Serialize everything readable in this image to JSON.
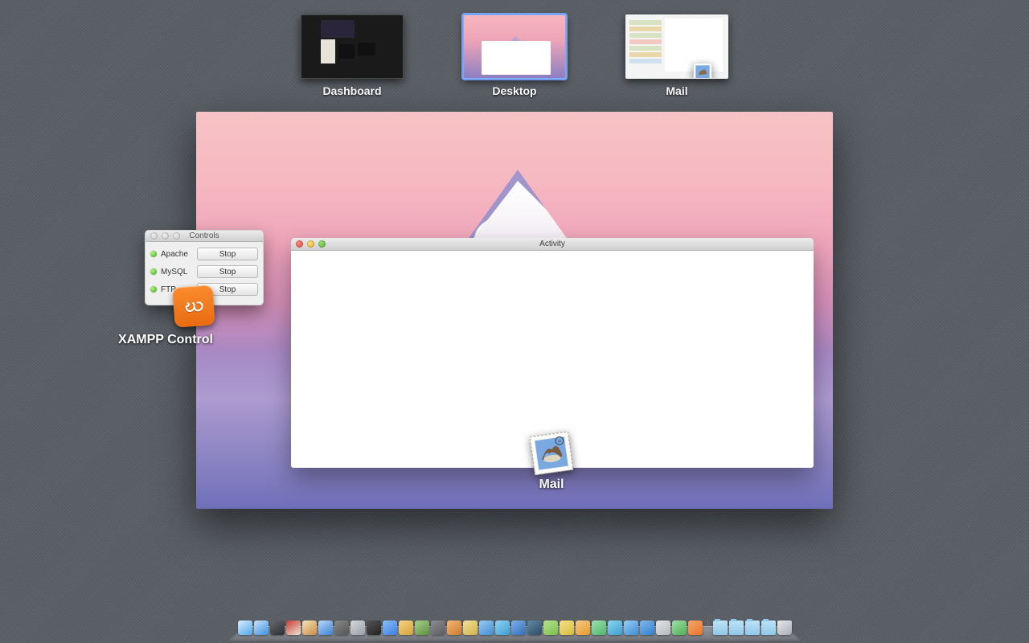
{
  "spaces": [
    {
      "id": "dashboard",
      "label": "Dashboard",
      "selected": false
    },
    {
      "id": "desktop",
      "label": "Desktop",
      "selected": true
    },
    {
      "id": "mail",
      "label": "Mail",
      "selected": false
    }
  ],
  "desktop_preview": {
    "activity_window": {
      "title": "Activity",
      "traffic": {
        "close": "red",
        "minimize": "yellow",
        "zoom": "green"
      }
    },
    "app_label": "Mail"
  },
  "xampp": {
    "window_title": "Controls",
    "services": [
      {
        "name": "Apache",
        "status": "running",
        "button": "Stop"
      },
      {
        "name": "MySQL",
        "status": "running",
        "button": "Stop"
      },
      {
        "name": "FTP",
        "status": "running",
        "button": "Stop"
      }
    ],
    "icon_text": "ဃ",
    "label": "XAMPP Control"
  },
  "dock": {
    "apps": [
      {
        "id": "finder",
        "c1": "#4aa7ee",
        "c2": "#dfeffb"
      },
      {
        "id": "safari",
        "c1": "#3f8fe0",
        "c2": "#c9e2f6"
      },
      {
        "id": "mission",
        "c1": "#2b2b30",
        "c2": "#6a6a72"
      },
      {
        "id": "calendar",
        "c1": "#efe7d6",
        "c2": "#c63a32"
      },
      {
        "id": "notes",
        "c1": "#c88a4b",
        "c2": "#f5e6b3"
      },
      {
        "id": "safari2",
        "c1": "#3a81d6",
        "c2": "#bcd9f2"
      },
      {
        "id": "photo",
        "c1": "#555",
        "c2": "#888"
      },
      {
        "id": "pref",
        "c1": "#9aa0a6",
        "c2": "#d4d7da"
      },
      {
        "id": "term",
        "c1": "#222",
        "c2": "#555"
      },
      {
        "id": "itunes",
        "c1": "#3b7fe2",
        "c2": "#8cbef3"
      },
      {
        "id": "imovie",
        "c1": "#d6a23a",
        "c2": "#f2d38a"
      },
      {
        "id": "app",
        "c1": "#5e8f3e",
        "c2": "#a7d18b"
      },
      {
        "id": "u1",
        "c1": "#5c5c60",
        "c2": "#8d8d92"
      },
      {
        "id": "u2",
        "c1": "#d07a2e",
        "c2": "#f0b877"
      },
      {
        "id": "u3",
        "c1": "#d2b24a",
        "c2": "#f2df9b"
      },
      {
        "id": "u4",
        "c1": "#3f8ed3",
        "c2": "#9ccaf0"
      },
      {
        "id": "u5",
        "c1": "#3aa0d8",
        "c2": "#93d2f2"
      },
      {
        "id": "word",
        "c1": "#2f6db8",
        "c2": "#7fb2e6"
      },
      {
        "id": "ps",
        "c1": "#2d4b63",
        "c2": "#5f8aa6"
      },
      {
        "id": "u6",
        "c1": "#7bbf4a",
        "c2": "#b7e38f"
      },
      {
        "id": "u7",
        "c1": "#d9bd3a",
        "c2": "#f2e08a"
      },
      {
        "id": "u8",
        "c1": "#e69a2e",
        "c2": "#f4c986"
      },
      {
        "id": "u9",
        "c1": "#4fb76a",
        "c2": "#9fe0b0"
      },
      {
        "id": "u10",
        "c1": "#3a9fd0",
        "c2": "#8fd4f0"
      },
      {
        "id": "spotify",
        "c1": "#3a8ed8",
        "c2": "#9bccf2"
      },
      {
        "id": "dropbox",
        "c1": "#2f7fcf",
        "c2": "#85b8e8"
      },
      {
        "id": "u11",
        "c1": "#b5b8bc",
        "c2": "#e3e5e8"
      },
      {
        "id": "u12",
        "c1": "#4fae55",
        "c2": "#a0e0a5"
      },
      {
        "id": "xampp",
        "c1": "#e8732a",
        "c2": "#f4a86a"
      }
    ],
    "right": [
      {
        "id": "folder1"
      },
      {
        "id": "folder2"
      },
      {
        "id": "folder3"
      },
      {
        "id": "folder4"
      },
      {
        "id": "trash"
      }
    ]
  }
}
